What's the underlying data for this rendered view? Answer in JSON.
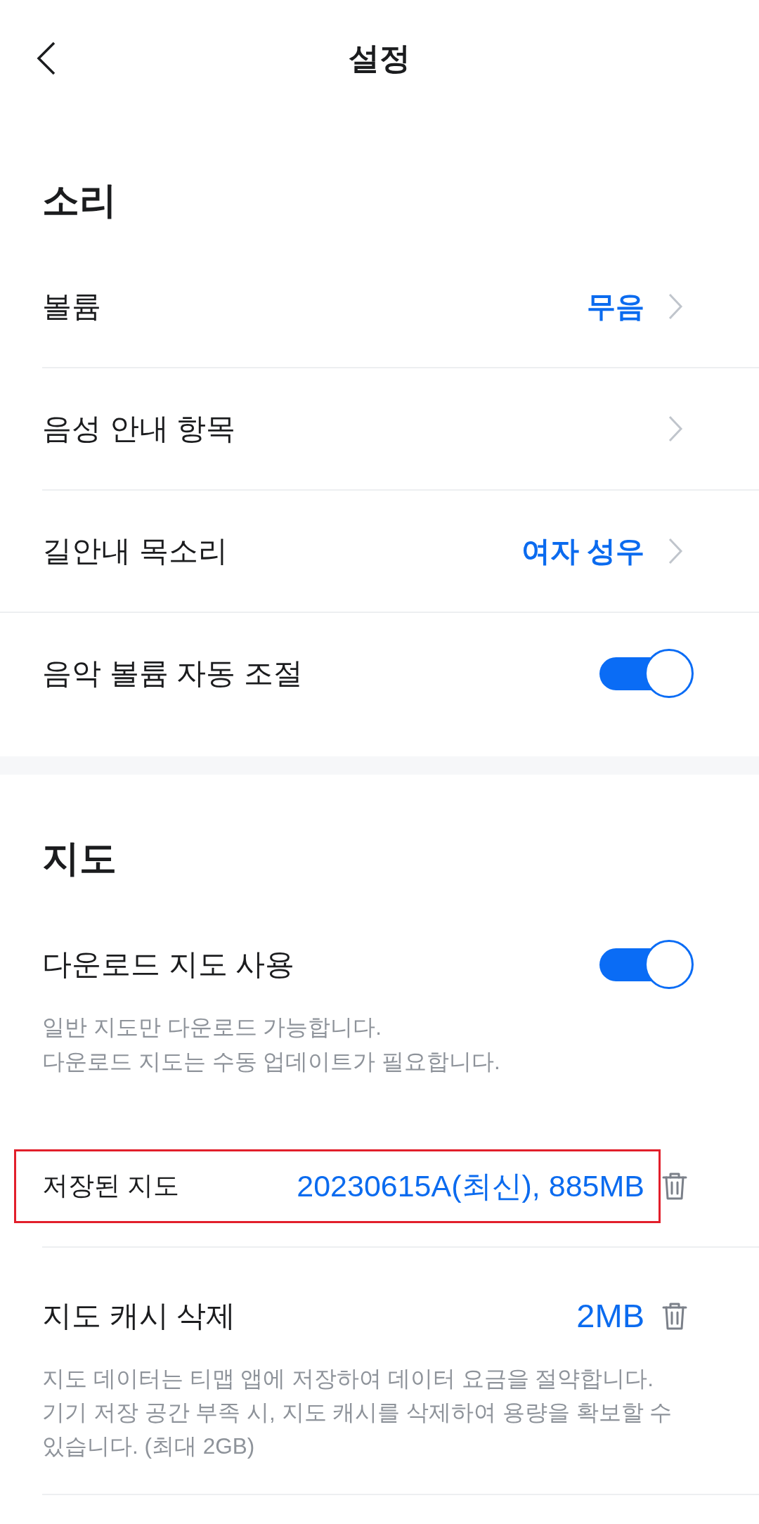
{
  "header": {
    "title": "설정"
  },
  "sections": [
    {
      "title": "소리",
      "rows": [
        {
          "kind": "link",
          "label": "볼륨",
          "value": "무음"
        },
        {
          "kind": "link",
          "label": "음성 안내 항목"
        },
        {
          "kind": "link",
          "label": "길안내 목소리",
          "value": "여자 성우"
        },
        {
          "kind": "toggle",
          "label": "음악 볼륨 자동 조절",
          "on": true
        }
      ]
    },
    {
      "title": "지도",
      "rows": [
        {
          "kind": "toggle",
          "label": "다운로드 지도 사용",
          "on": true,
          "description": [
            "일반 지도만 다운로드 가능합니다.",
            "다운로드 지도는 수동 업데이트가 필요합니다."
          ]
        },
        {
          "kind": "file",
          "label": "저장된 지도",
          "value": "20230615A(최신), 885MB",
          "highlighted": true
        },
        {
          "kind": "delete",
          "label": "지도 캐시 삭제",
          "value": "2MB",
          "highlighted": false,
          "description": [
            "지도 데이터는 티맵 앱에 저장하여 데이터 요금을 절약합니다.",
            "기기 저장 공간 부족 시, 지도 캐시를 삭제하여 용량을 확보할 수 있습니다. (최대 2GB)"
          ]
        }
      ]
    }
  ]
}
